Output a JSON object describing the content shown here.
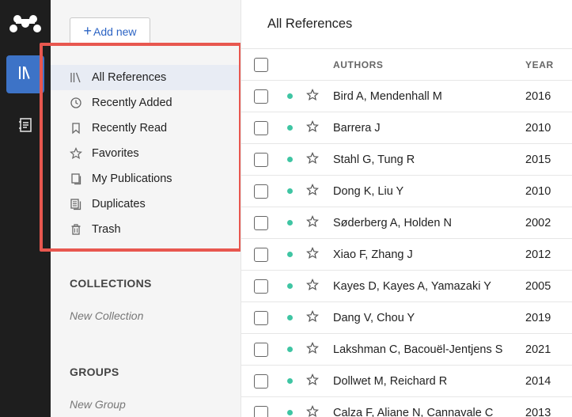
{
  "rail": {
    "logo_icon": "mendeley-logo-icon",
    "library_icon": "library-icon",
    "notebook_icon": "notebook-icon",
    "active_color": "#3d73c7"
  },
  "sidebar": {
    "add_new_plus": "+",
    "add_new_label": "Add new",
    "items": [
      {
        "label": "All References",
        "icon": "library-icon",
        "active": true
      },
      {
        "label": "Recently Added",
        "icon": "clock-icon"
      },
      {
        "label": "Recently Read",
        "icon": "bookmark-icon"
      },
      {
        "label": "Favorites",
        "icon": "star-icon"
      },
      {
        "label": "My Publications",
        "icon": "publications-icon"
      },
      {
        "label": "Duplicates",
        "icon": "duplicates-icon"
      },
      {
        "label": "Trash",
        "icon": "trash-icon"
      }
    ],
    "collections_label": "COLLECTIONS",
    "new_collection": "New Collection",
    "groups_label": "GROUPS",
    "new_group": "New Group",
    "highlight_color": "#e8574f"
  },
  "main": {
    "title": "All References",
    "columns": {
      "authors": "AUTHORS",
      "year": "YEAR"
    },
    "status_dot_color": "#3fc5a3",
    "rows": [
      {
        "authors": "Bird A, Mendenhall M",
        "year": "2016"
      },
      {
        "authors": "Barrera J",
        "year": "2010"
      },
      {
        "authors": "Stahl G, Tung R",
        "year": "2015"
      },
      {
        "authors": "Dong K, Liu Y",
        "year": "2010"
      },
      {
        "authors": "Søderberg A, Holden N",
        "year": "2002"
      },
      {
        "authors": "Xiao F, Zhang J",
        "year": "2012"
      },
      {
        "authors": "Kayes D, Kayes A, Yamazaki Y",
        "year": "2005"
      },
      {
        "authors": "Dang V, Chou Y",
        "year": "2019"
      },
      {
        "authors": "Lakshman C, Bacouël-Jentjens S",
        "year": "2021"
      },
      {
        "authors": "Dollwet M, Reichard R",
        "year": "2014"
      },
      {
        "authors": "Calza F, Aliane N, Cannavale C",
        "year": "2013"
      }
    ]
  }
}
